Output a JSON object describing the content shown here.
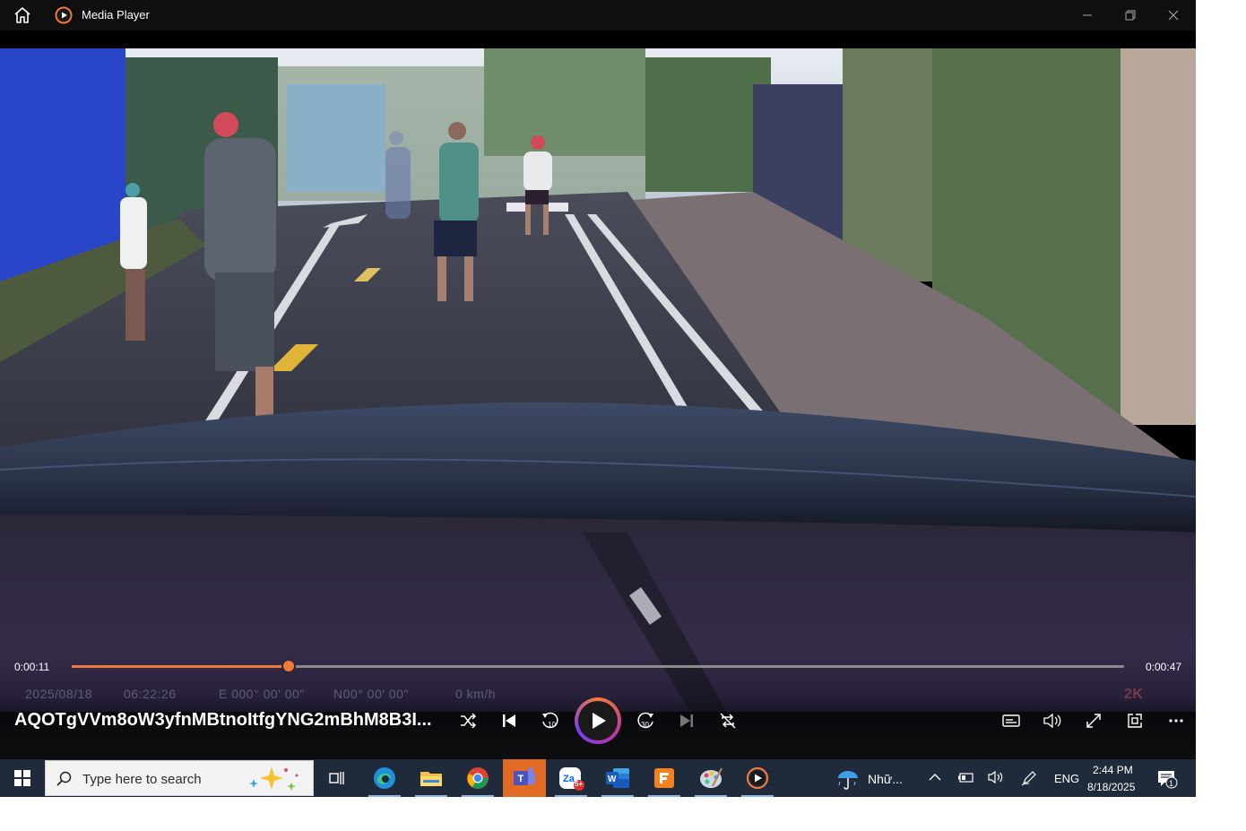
{
  "window": {
    "title": "Media Player",
    "accent": "#f07a3c"
  },
  "video": {
    "stamp_date": "2025/08/18",
    "stamp_time": "06:22:26",
    "stamp_lon": "E 000° 00' 00\"",
    "stamp_lat": "N00° 00' 00\"",
    "stamp_speed": "0 km/h",
    "stamp_res": "2K"
  },
  "playback": {
    "current_time": "0:00:11",
    "total_time": "0:00:47",
    "progress": 0.206,
    "media_title": "AQOTgVVm8oW3yfnMBtnoItfgYNG2mBhM8B3I...",
    "controls": [
      "shuffle-icon",
      "previous-icon",
      "rewind-10-icon",
      "play-icon",
      "forward-30-icon",
      "next-icon",
      "repeat-icon",
      "captions-icon",
      "volume-icon",
      "fullscreen-icon",
      "miniplayer-icon",
      "more-icon"
    ]
  },
  "taskbar": {
    "search_placeholder": "Type here to search",
    "zalo_badge": "5+",
    "weather_text": "Nhữ...",
    "language": "ENG",
    "time": "2:44 PM",
    "date": "8/18/2025",
    "notification_count": "1"
  }
}
